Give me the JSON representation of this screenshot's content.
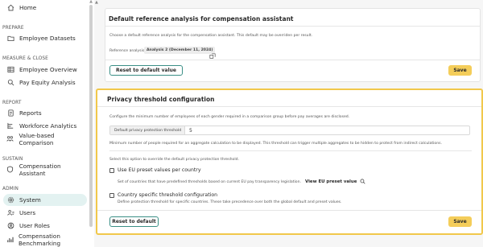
{
  "sidebar": {
    "home": "Home",
    "sections": {
      "prepare": "PREPARE",
      "measure": "MEASURE & CLOSE",
      "report": "REPORT",
      "sustain": "SUSTAIN",
      "admin": "ADMIN"
    },
    "items": {
      "employee_datasets": "Employee Datasets",
      "employee_overview": "Employee Overview",
      "pay_equity_analysis": "Pay Equity Analysis",
      "reports": "Reports",
      "workforce_analytics": "Workforce Analytics",
      "value_based_comparison": "Value-based Comparison",
      "compensation_assistant": "Compensation Assistant",
      "system": "System",
      "users": "Users",
      "user_roles": "User Roles",
      "compensation_benchmarking": "Compensation Benchmarking"
    },
    "active_item": "system",
    "active_bg": "#e3f2f1"
  },
  "ref_card": {
    "title": "Default reference analysis for compensation assistant",
    "description": "Choose a default reference analysis for the compensation assistant. This default may be overriden per result.",
    "ref_label": "Reference analysis",
    "ref_value": "Analysis 2 (December 11, 2024)",
    "reset_label": "Reset to default value",
    "save_label": "Save"
  },
  "privacy_card": {
    "title": "Privacy threshold configuration",
    "description": "Configure the minimum number of employees of each gender required in a comparison group before pay averages are disclosed.",
    "field_label": "Default privacy protection threshold",
    "field_value": "5",
    "field_help": "Minimum number of people required for an aggregate calculation to be displayed. This threshold can trigger multiple aggregates to be hidden to protect from indirect calculations.",
    "override_text": "Select this option to override the default privacy protection threshold.",
    "eu_option": {
      "label": "Use EU preset values per country",
      "help": "Set of countries that have predefined thresholds based on current EU pay transparency legislation.",
      "link": "View EU preset value",
      "checked": false
    },
    "country_option": {
      "label": "Country specific threshold configuration",
      "help": "Define protection threshold for specific countries. These take precedence over both the global default and preset values.",
      "checked": false
    },
    "reset_label": "Reset to default",
    "save_label": "Save",
    "highlight_color": "#f1c84b"
  },
  "colors": {
    "accent_teal": "#3a8f86",
    "save_yellow": "#f4cd5a"
  }
}
